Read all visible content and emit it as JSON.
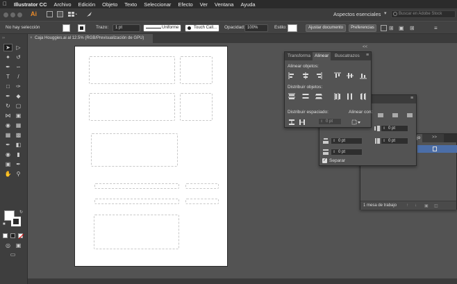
{
  "menubar": {
    "items": [
      {
        "label": "Illustrator CC",
        "bold": true
      },
      {
        "label": "Archivo"
      },
      {
        "label": "Edición"
      },
      {
        "label": "Objeto"
      },
      {
        "label": "Texto"
      },
      {
        "label": "Seleccionar"
      },
      {
        "label": "Efecto"
      },
      {
        "label": "Ver"
      },
      {
        "label": "Ventana"
      },
      {
        "label": "Ayuda"
      }
    ]
  },
  "appbar": {
    "logo": "Ai",
    "workspace": "Aspectos esenciales",
    "stock_search_placeholder": "Buscar en Adobe Stock"
  },
  "control_bar": {
    "selection_status": "No hay selección",
    "stroke_label": "Trazo:",
    "stroke_weight": "1 pt",
    "stroke_profile": "Uniforme",
    "brush": "Touch Call...",
    "opacity_label": "Opacidad:",
    "opacity_value": "100%",
    "style_label": "Estilo:",
    "align_doc_button": "Ajustar documento",
    "prefs_button": "Preferencias"
  },
  "document_tab": {
    "close": "×",
    "title": "Caja Houggies.ai al 12.5% (RGB/Previsualización de GPU)"
  },
  "align_panel": {
    "tabs": [
      "Transforma",
      "Alinear",
      "Buscatrazos"
    ],
    "active_tab": "Alinear",
    "align_objects_label": "Alinear objetos:",
    "distribute_objects_label": "Distribuir objetos:",
    "distribute_spacing_label": "Distribuir espaciado:",
    "align_to_label": "Alinear con:",
    "spacing_value": "0 pt",
    "expand_icon": "<<",
    "menu_icon": "≡"
  },
  "transform_panel": {
    "fields": [
      "0 pt",
      "0 pt",
      "0 pt",
      "0 pt"
    ],
    "separate_checkbox_label": "Separar",
    "separate_checked": true
  },
  "artboards_panel": {
    "tab_partial": "jo",
    "footer": "1 mesa de trabajo",
    "expand_icon": ">>"
  },
  "colors": {
    "menubar_bg": "#2b2b2b",
    "app_bg": "#535353",
    "panel_bg": "#535353",
    "artboard": "#ffffff",
    "logo": "#e88a2a",
    "selection_blue": "#4b6ea8"
  }
}
